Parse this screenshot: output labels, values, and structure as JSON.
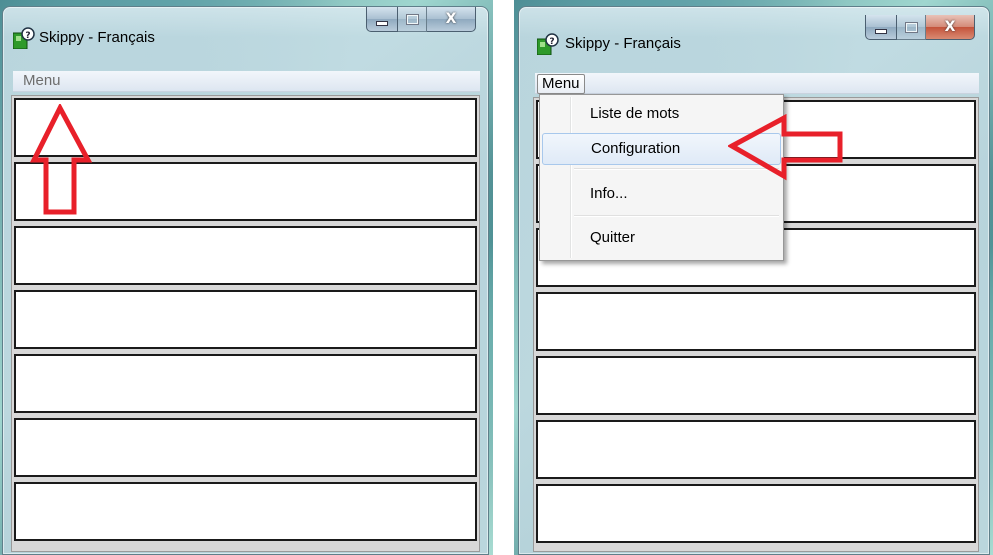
{
  "window_title": "Skippy - Français",
  "menu_label": "Menu",
  "dropdown": {
    "items": [
      "Liste de mots",
      "Configuration",
      "Info...",
      "Quitter"
    ],
    "highlighted": "Configuration"
  },
  "window_controls": {
    "minimize_glyph": "",
    "maximize_glyph": "",
    "close_glyph": "X"
  },
  "colors": {
    "annotation_arrow": "#e8202a",
    "highlight_border": "#a8c8ec"
  },
  "icons": [
    "app-icon",
    "minimize-icon",
    "maximize-icon",
    "close-icon",
    "arrow-annotation-up",
    "arrow-annotation-left"
  ]
}
